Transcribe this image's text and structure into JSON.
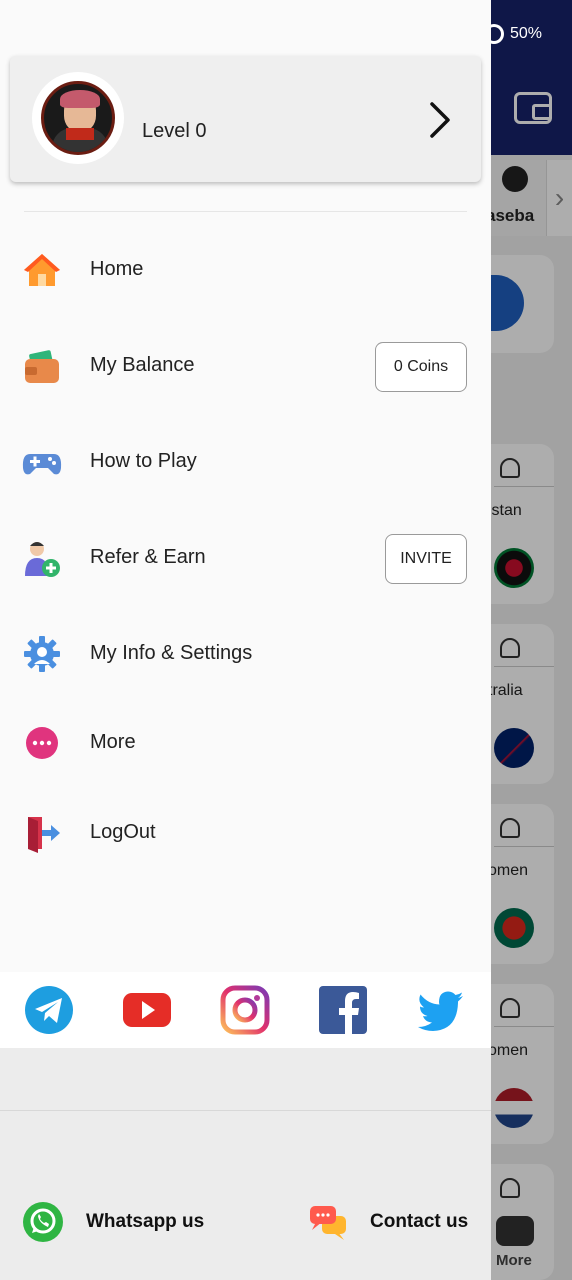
{
  "status_bar": {
    "time": "",
    "battery": "50%"
  },
  "background": {
    "sport_label": "aseba",
    "cards": [
      {
        "text": "istan"
      },
      {
        "text": "tralia"
      },
      {
        "text": "omen"
      },
      {
        "text": "omen"
      }
    ],
    "more_label": "More"
  },
  "profile": {
    "level": "Level 0"
  },
  "menu": [
    {
      "label": "Home",
      "icon": "home-icon"
    },
    {
      "label": "My Balance",
      "icon": "wallet-icon",
      "badge": "0 Coins"
    },
    {
      "label": "How to Play",
      "icon": "gamepad-icon"
    },
    {
      "label": "Refer & Earn",
      "icon": "refer-icon",
      "badge": "INVITE"
    },
    {
      "label": "My Info & Settings",
      "icon": "settings-icon"
    },
    {
      "label": "More",
      "icon": "more-icon"
    },
    {
      "label": "LogOut",
      "icon": "logout-icon"
    }
  ],
  "social": [
    "telegram-icon",
    "youtube-icon",
    "instagram-icon",
    "facebook-icon",
    "twitter-icon"
  ],
  "footer": {
    "whatsapp_label": "Whatsapp us",
    "contact_label": "Contact us"
  },
  "colors": {
    "header": "#17236b",
    "drawer": "#fafafa",
    "accent_orange": "#ff7a1a"
  }
}
